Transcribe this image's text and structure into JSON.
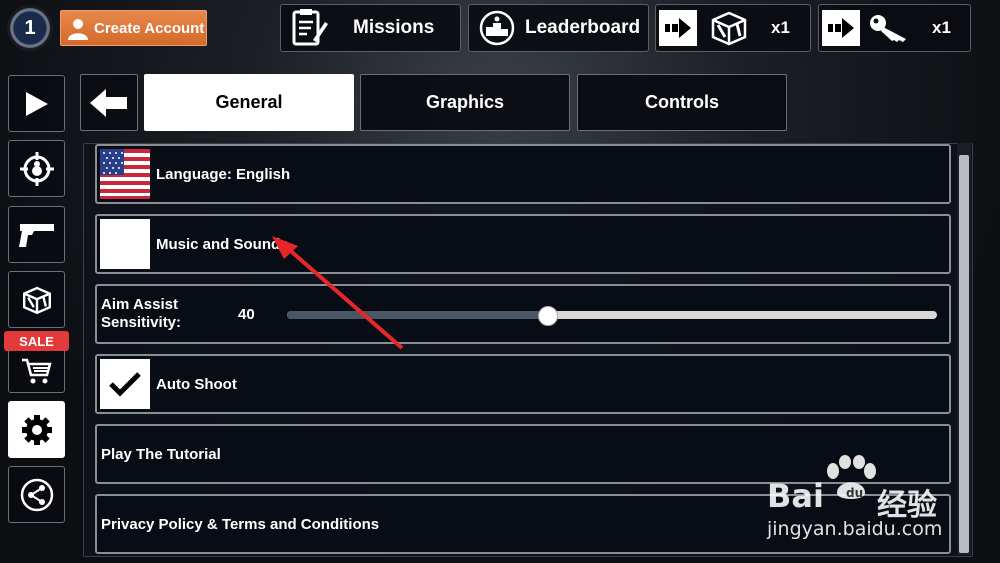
{
  "top_bar": {
    "level": "1",
    "create_account_label": "Create Account",
    "missions_label": "Missions",
    "leaderboard_label": "Leaderboard",
    "crate_count": "x1",
    "key_count": "x1"
  },
  "sidebar": {
    "items": [
      {
        "name": "play",
        "icon": "play-icon"
      },
      {
        "name": "target",
        "icon": "crosshair-icon"
      },
      {
        "name": "weapons",
        "icon": "pistol-icon"
      },
      {
        "name": "crates",
        "icon": "crate-icon"
      },
      {
        "name": "shop",
        "icon": "cart-icon"
      },
      {
        "name": "settings",
        "icon": "gear-icon",
        "active": true
      },
      {
        "name": "share",
        "icon": "share-icon"
      }
    ],
    "sale_badge": "SALE"
  },
  "tabs": [
    {
      "label": "General",
      "active": true
    },
    {
      "label": "Graphics",
      "active": false
    },
    {
      "label": "Controls",
      "active": false
    }
  ],
  "settings": {
    "language_label": "Language: English",
    "music_label": "Music and Sounds",
    "music_enabled": false,
    "aim_label_line1": "Aim Assist",
    "aim_label_line2": "Sensitivity:",
    "aim_value": "40",
    "aim_fraction": 0.4,
    "auto_shoot_label": "Auto Shoot",
    "auto_shoot_enabled": true,
    "tutorial_label": "Play The Tutorial",
    "privacy_label": "Privacy Policy & Terms and Conditions"
  },
  "watermark": {
    "brand": "Bai",
    "brand_cn": "经验",
    "url": "jingyan.baidu.com"
  },
  "colors": {
    "accent_orange": "#d9733a",
    "sale_red": "#e23a3a",
    "annotation_arrow": "#e8262a"
  }
}
